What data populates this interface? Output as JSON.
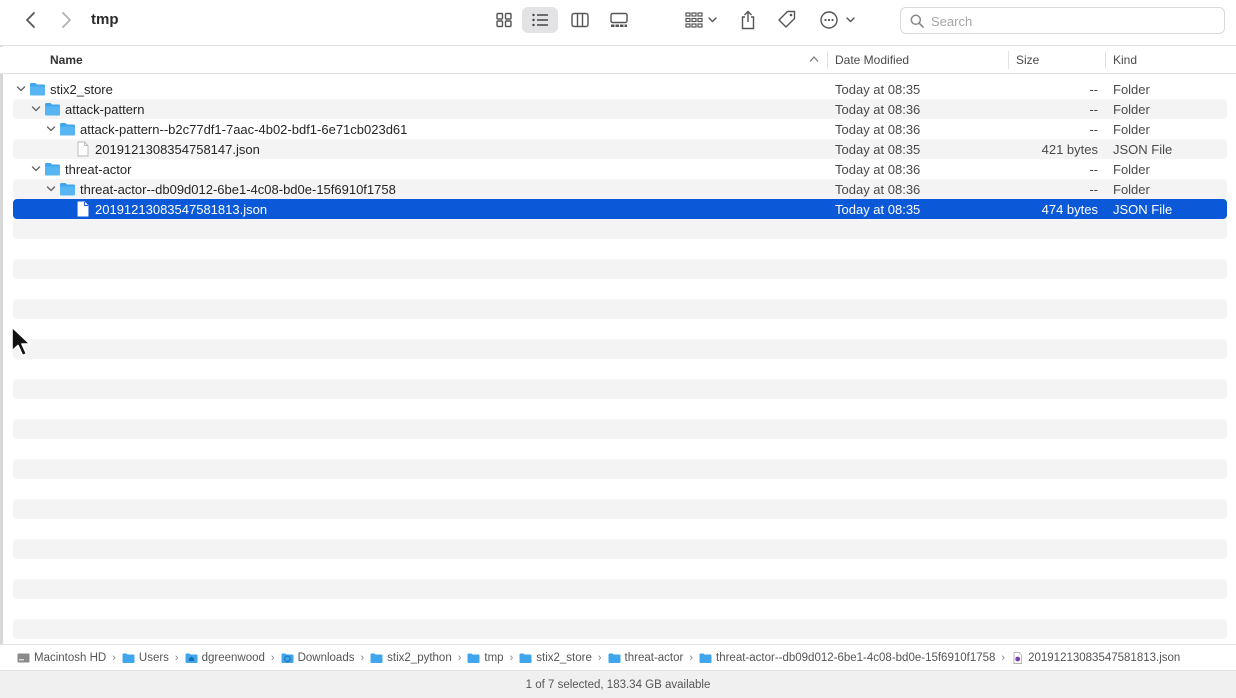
{
  "window": {
    "title": "tmp"
  },
  "toolbar": {
    "search_placeholder": "Search",
    "views": [
      "icon-view",
      "list-view",
      "column-view",
      "gallery-view"
    ],
    "active_view": "list-view"
  },
  "columns": {
    "name": "Name",
    "date": "Date Modified",
    "size": "Size",
    "kind": "Kind"
  },
  "rows": [
    {
      "name": "stix2_store",
      "date": "Today at 08:35",
      "size": "--",
      "kind": "Folder",
      "type": "folder",
      "level": 0,
      "expanded": true
    },
    {
      "name": "attack-pattern",
      "date": "Today at 08:36",
      "size": "--",
      "kind": "Folder",
      "type": "folder",
      "level": 1,
      "expanded": true
    },
    {
      "name": "attack-pattern--b2c77df1-7aac-4b02-bdf1-6e71cb023d61",
      "date": "Today at 08:36",
      "size": "--",
      "kind": "Folder",
      "type": "folder",
      "level": 2,
      "expanded": true
    },
    {
      "name": "20191213083547581 47.json",
      "date": "Today at 08:35",
      "size": "421 bytes",
      "kind": "JSON File",
      "type": "file",
      "level": 3
    },
    {
      "name": "threat-actor",
      "date": "Today at 08:36",
      "size": "--",
      "kind": "Folder",
      "type": "folder",
      "level": 1,
      "expanded": true
    },
    {
      "name": "threat-actor--db09d012-6be1-4c08-bd0e-15f6910f1758",
      "date": "Today at 08:36",
      "size": "--",
      "kind": "Folder",
      "type": "folder",
      "level": 2,
      "expanded": true
    },
    {
      "name": "20191213083547581813.json",
      "date": "Today at 08:35",
      "size": "474 bytes",
      "kind": "JSON File",
      "type": "file",
      "level": 3,
      "selected": true
    }
  ],
  "path": [
    {
      "label": "Macintosh HD",
      "icon": "disk-icon"
    },
    {
      "label": "Users",
      "icon": "folder-icon"
    },
    {
      "label": "dgreenwood",
      "icon": "home-folder-icon"
    },
    {
      "label": "Downloads",
      "icon": "downloads-folder-icon"
    },
    {
      "label": "stix2_python",
      "icon": "folder-icon"
    },
    {
      "label": "tmp",
      "icon": "folder-icon"
    },
    {
      "label": "stix2_store",
      "icon": "folder-icon"
    },
    {
      "label": "threat-actor",
      "icon": "folder-icon"
    },
    {
      "label": "threat-actor--db09d012-6be1-4c08-bd0e-15f6910f1758",
      "icon": "folder-icon"
    },
    {
      "label": "20191213083547581813.json",
      "icon": "json-file-icon"
    }
  ],
  "status": "1 of 7 selected, 183.34 GB available",
  "colors": {
    "selection": "#0b59d8",
    "folder": "#3fa6ee",
    "stripe": "#f4f4f5"
  }
}
